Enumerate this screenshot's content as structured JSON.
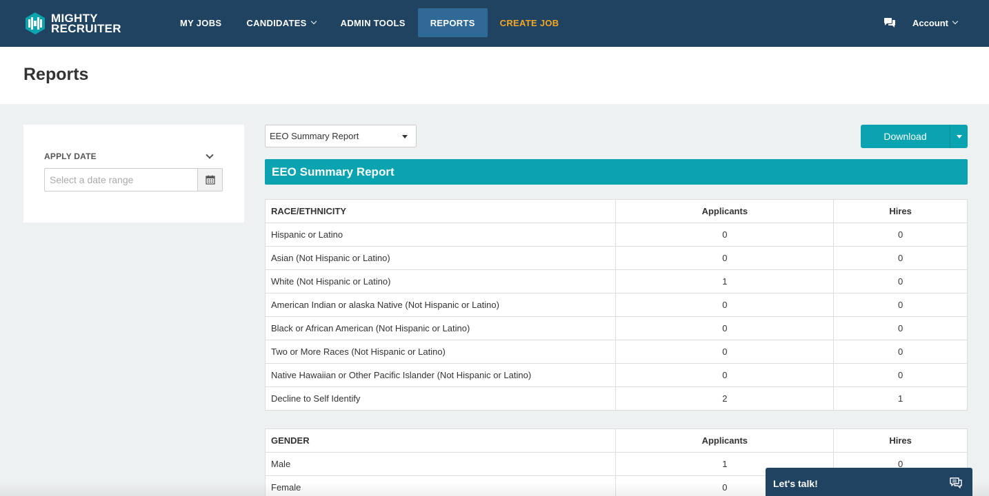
{
  "brand": {
    "line1": "MIGHTY",
    "line2": "RECRUITER",
    "logo_icon": "mr-hexagon-logo",
    "color_nav": "#1f4361",
    "color_accent": "#0aa3b0",
    "color_create": "#f5a623"
  },
  "nav": {
    "items": [
      {
        "label": "MY JOBS"
      },
      {
        "label": "CANDIDATES"
      },
      {
        "label": "ADMIN TOOLS"
      },
      {
        "label": "REPORTS"
      },
      {
        "label": "CREATE JOB"
      }
    ],
    "account_label": "Account"
  },
  "page": {
    "title": "Reports"
  },
  "filter": {
    "label": "APPLY DATE",
    "date_placeholder": "Select a date range"
  },
  "report": {
    "selected": "EEO Summary Report",
    "download_label": "Download",
    "banner_title": "EEO Summary Report"
  },
  "race_table": {
    "headers": [
      "RACE/ETHNICITY",
      "Applicants",
      "Hires"
    ],
    "rows": [
      [
        "Hispanic or Latino",
        "0",
        "0"
      ],
      [
        "Asian (Not Hispanic or Latino)",
        "0",
        "0"
      ],
      [
        "White (Not Hispanic or Latino)",
        "1",
        "0"
      ],
      [
        "American Indian or alaska Native (Not Hispanic or Latino)",
        "0",
        "0"
      ],
      [
        "Black or African American (Not Hispanic or Latino)",
        "0",
        "0"
      ],
      [
        "Two or More Races (Not Hispanic or Latino)",
        "0",
        "0"
      ],
      [
        "Native Hawaiian or Other Pacific Islander (Not Hispanic or Latino)",
        "0",
        "0"
      ],
      [
        "Decline to Self Identify",
        "2",
        "1"
      ]
    ]
  },
  "gender_table": {
    "headers": [
      "GENDER",
      "Applicants",
      "Hires"
    ],
    "rows": [
      [
        "Male",
        "1",
        "0"
      ],
      [
        "Female",
        "0",
        "0"
      ]
    ]
  },
  "chat_widget": {
    "label": "Let's talk!"
  }
}
